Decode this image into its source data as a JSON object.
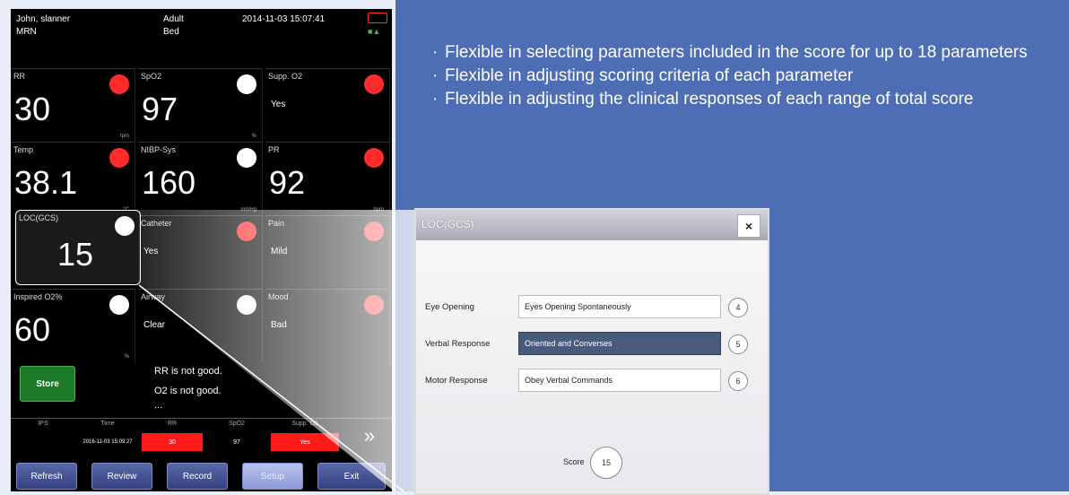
{
  "monitor": {
    "header": {
      "patient_name": "John, slanner",
      "mrn_label": "MRN",
      "patient_type": "Adult",
      "bed_label": "Bed",
      "datetime": "2014-11-03 15:07:41"
    },
    "tiles": [
      {
        "label": "RR",
        "value": "30",
        "unit": "rpm",
        "indicator": "red"
      },
      {
        "label": "SpO2",
        "value": "97",
        "unit": "%",
        "indicator": "white"
      },
      {
        "label": "Supp. O2",
        "text": "Yes",
        "indicator": "red"
      },
      {
        "label": "Temp",
        "value": "38.1",
        "unit": "°C",
        "indicator": "red"
      },
      {
        "label": "NIBP-Sys",
        "value": "160",
        "unit": "mmHg",
        "indicator": "white"
      },
      {
        "label": "PR",
        "value": "92",
        "unit": "bpm",
        "indicator": "red"
      },
      {
        "label": "LOC(GCS)",
        "value": "15",
        "indicator": "white"
      },
      {
        "label": "Catheter",
        "text": "Yes",
        "indicator": "red"
      },
      {
        "label": "Pain",
        "text": "Mild",
        "indicator": "red"
      },
      {
        "label": "Inspired O2%",
        "value": "60",
        "unit": "%",
        "indicator": "white"
      },
      {
        "label": "Airway",
        "text": "Clear",
        "indicator": "white"
      },
      {
        "label": "Mood",
        "text": "Bad",
        "indicator": "red"
      }
    ],
    "store_label": "Store",
    "messages": [
      "RR is not good.",
      "O2 is not good.",
      "..."
    ],
    "trend": {
      "headers": [
        "IPS",
        "Time",
        "RR",
        "SpO2",
        "Supp. O2"
      ],
      "values": [
        "",
        "2016-11-03 15:09:27",
        "30",
        "97",
        "Yes"
      ]
    },
    "buttons": [
      "Refresh",
      "Review",
      "Record",
      "Setup",
      "Exit"
    ],
    "active_button": "Setup"
  },
  "bullets": [
    "Flexible in selecting parameters included in the score for up to 18 parameters",
    "Flexible in adjusting scoring criteria of each parameter",
    "Flexible in adjusting the clinical responses of each range of total score"
  ],
  "dialog": {
    "title": "LOC(GCS)",
    "close_glyph": "×",
    "rows": [
      {
        "label": "Eye Opening",
        "value": "Eyes Opening Spontaneously",
        "score": "4",
        "selected": false
      },
      {
        "label": "Verbal Response",
        "value": "Oriented and Converses",
        "score": "5",
        "selected": true
      },
      {
        "label": "Motor Response",
        "value": "Obey Verbal Commands",
        "score": "6",
        "selected": false
      }
    ],
    "total_label": "Score",
    "total_value": "15"
  },
  "colors": {
    "panel_bg": "#4d6db4",
    "alarm_red": "#ff2a2a",
    "store_green": "#1d7a28",
    "selected_field": "#4a5a7a"
  }
}
